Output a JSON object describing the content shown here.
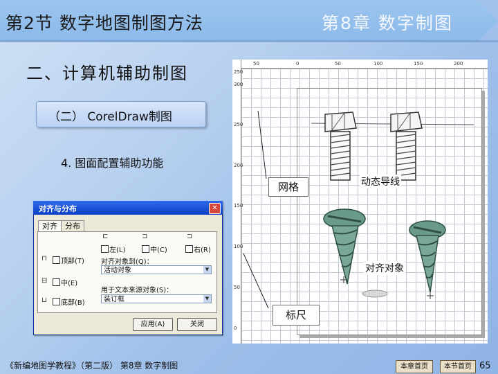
{
  "header": {
    "section_title": "第2节  数字地图制图方法",
    "chapter_title": "第8章  数字制图"
  },
  "heading": "二、计算机辅助制图",
  "pill_label": "（二） CorelDraw制图",
  "subheading": "4. 图面配置辅助功能",
  "dialog": {
    "title": "对齐与分布",
    "close": "✕",
    "tabs": [
      "对齐",
      "分布"
    ],
    "h_options": [
      "左(L)",
      "中(C)",
      "右(R)"
    ],
    "v_options": [
      "顶部(T)",
      "中(E)",
      "底部(B)"
    ],
    "align_to_label": "对齐对象到(Q)：",
    "align_to_value": "活动对象",
    "text_source_label": "用于文本来源对象(S)：",
    "text_source_value": "装订框",
    "apply": "应用(A)",
    "close_btn": "关闭"
  },
  "ruler": {
    "top_ticks": [
      "50",
      "0",
      "50",
      "100",
      "150",
      "200"
    ],
    "left_ticks": [
      "250",
      "300",
      "250",
      "200",
      "150",
      "100",
      "50",
      "0"
    ]
  },
  "labels": {
    "grid": "网格",
    "guides": "动态导线",
    "align": "对齐对象",
    "ruler": "标尺"
  },
  "footer": {
    "book": "《新编地图学教程》（第二版）  第8章  数字制图",
    "chapter_home": "本章首页",
    "section_home": "本节首页",
    "page": "65"
  },
  "colors": {
    "accent": "#8bb9ea",
    "title_bar": "#0a3fc6"
  }
}
